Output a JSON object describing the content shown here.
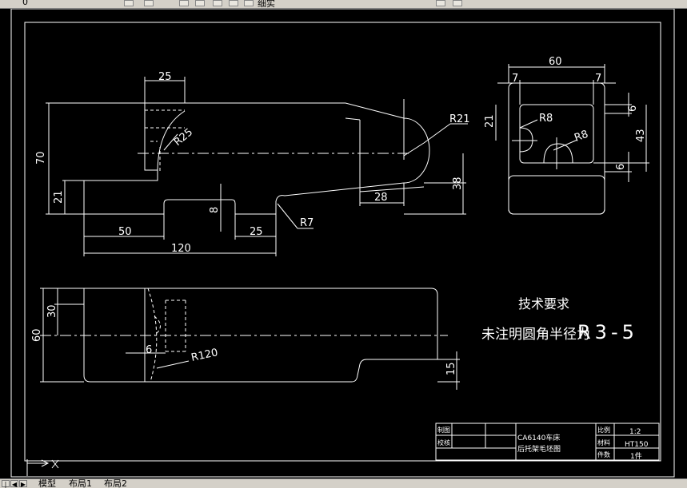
{
  "toolbar": {
    "layer_text": "0",
    "item_text": "细实"
  },
  "drawing": {
    "dims": {
      "d25_top": "25",
      "d70": "70",
      "d21_left": "21",
      "r25": "R25",
      "r21": "R21",
      "d38": "38",
      "d28": "28",
      "d8": "8",
      "r7": "R7",
      "d50": "50",
      "d25_bottom": "25",
      "d120": "120",
      "d60_side": "60",
      "d7_left": "7",
      "d7_right": "7",
      "d21_side": "21",
      "r8_upper": "R8",
      "r8_lower": "R8",
      "d6_upper": "6",
      "d43": "43",
      "d6_lower": "6",
      "d30": "30",
      "d60_plan": "60",
      "d6_plan": "6",
      "r120": "R120",
      "d15": "15"
    },
    "notes": {
      "title": "技术要求",
      "line1_cn": "未注明圆角半径为",
      "line1_val": "R3-5"
    },
    "title_block": {
      "drawn_label": "制图",
      "checked_label": "校核",
      "part_line1": "CA6140车床",
      "part_line2": "后托架毛坯图",
      "scale_label": "比例",
      "scale_value": "1:2",
      "material_label": "材料",
      "material_value": "HT150",
      "qty_label": "件数",
      "qty_value": "1件"
    }
  },
  "tabs": {
    "model": "模型",
    "layout1": "布局1",
    "layout2": "布局2"
  }
}
